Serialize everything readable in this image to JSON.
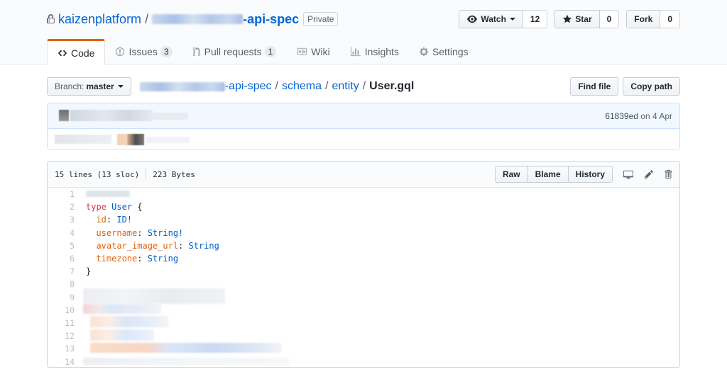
{
  "repo": {
    "owner": "kaizenplatform",
    "name_suffix": "-api-spec",
    "visibility": "Private"
  },
  "actions": {
    "watch_label": "Watch",
    "watch_count": "12",
    "star_label": "Star",
    "star_count": "0",
    "fork_label": "Fork",
    "fork_count": "0"
  },
  "tabs": [
    {
      "label": "Code",
      "icon": "code-icon",
      "selected": true
    },
    {
      "label": "Issues",
      "icon": "issue-icon",
      "count": "3"
    },
    {
      "label": "Pull requests",
      "icon": "pull-request-icon",
      "count": "1"
    },
    {
      "label": "Wiki",
      "icon": "book-icon"
    },
    {
      "label": "Insights",
      "icon": "graph-icon"
    },
    {
      "label": "Settings",
      "icon": "gear-icon"
    }
  ],
  "file_nav": {
    "branch_label": "Branch:",
    "branch_name": "master",
    "breadcrumb": [
      "-api-spec",
      "schema",
      "entity"
    ],
    "file_name": "User.gql",
    "separator": "/",
    "find_file": "Find file",
    "copy_path": "Copy path"
  },
  "commit": {
    "sha": "61839ed",
    "date_prefix": "on",
    "date": "4 Apr"
  },
  "file": {
    "lines_info": "15 lines (13 sloc)",
    "size": "223 Bytes",
    "raw": "Raw",
    "blame": "Blame",
    "history": "History",
    "line_numbers": [
      "1",
      "2",
      "3",
      "4",
      "5",
      "6",
      "7",
      "8",
      "9",
      "10",
      "11",
      "12",
      "13",
      "14"
    ],
    "code": {
      "l2_kw": "type",
      "l2_name": "User",
      "l2_brace": " {",
      "l3_field": "id",
      "l3_type": "ID!",
      "l4_field": "username",
      "l4_type": "String!",
      "l5_field": "avatar_image_url",
      "l5_type": "String",
      "l6_field": "timezone",
      "l6_type": "String",
      "l7_brace": "}",
      "colon": ": "
    }
  },
  "colors": {
    "link": "#0366d6",
    "selected_tab_accent": "#e36209",
    "keyword": "#d73a49",
    "type": "#005cc5",
    "field": "#e36209"
  }
}
